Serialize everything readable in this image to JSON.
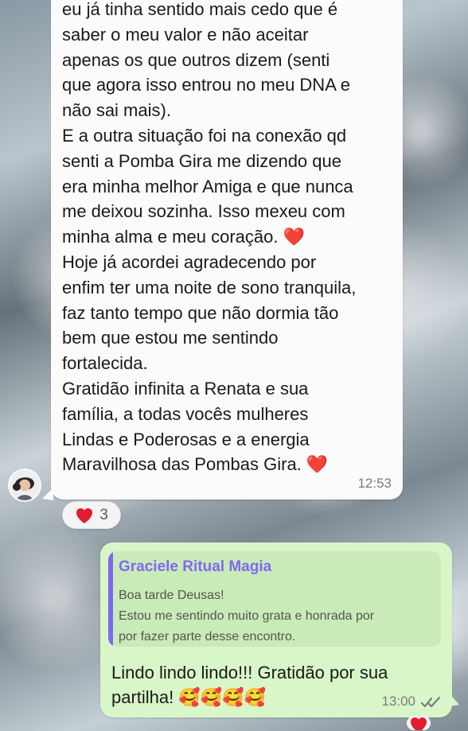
{
  "incoming_message": {
    "text": "eu já tinha sentido mais cedo que é\nsaber o meu valor e não aceitar\napenas os que outros dizem (senti\nque agora isso entrou no meu DNA e\nnão sai mais).\nE a outra situação foi na conexão qd\nsenti a Pomba Gira me dizendo que\nera minha melhor Amiga e que nunca\nme deixou sozinha. Isso mexeu com\nminha alma e meu coração. ❤️\nHoje já acordei agradecendo por\nenfim ter uma noite de sono tranquila,\nfaz tanto tempo que não dormia tão\nbem que estou me sentindo\nfortalecida.\nGratidão infinita a Renata e  sua\nfamília, a todas vocês mulheres\nLindas e Poderosas e a energia\nMaravilhosa das Pombas Gira. ❤️",
    "time": "12:53",
    "reaction": {
      "emoji": "❤️",
      "count": "3"
    }
  },
  "outgoing_message": {
    "quoted": {
      "author": "Graciele Ritual Magia",
      "text": "Boa tarde Deusas!\nEstou me sentindo muito grata e honrada por\npor fazer parte desse encontro."
    },
    "text": "Lindo lindo lindo!!! Gratidão por sua\npartilha! 🥰🥰🥰🥰",
    "time": "13:00",
    "status": "read"
  },
  "colors": {
    "incoming_bubble": "#fbfbfb",
    "outgoing_bubble": "#d8f6c8",
    "quote_background": "#c9ebb7",
    "quote_accent": "#7f69f2",
    "heart": "#e21d2d",
    "read_ticks": "#7d7d7d"
  },
  "icons": {
    "avatar": "user-avatar-icon",
    "reaction": "heart-icon",
    "read_status": "double-check-icon"
  }
}
